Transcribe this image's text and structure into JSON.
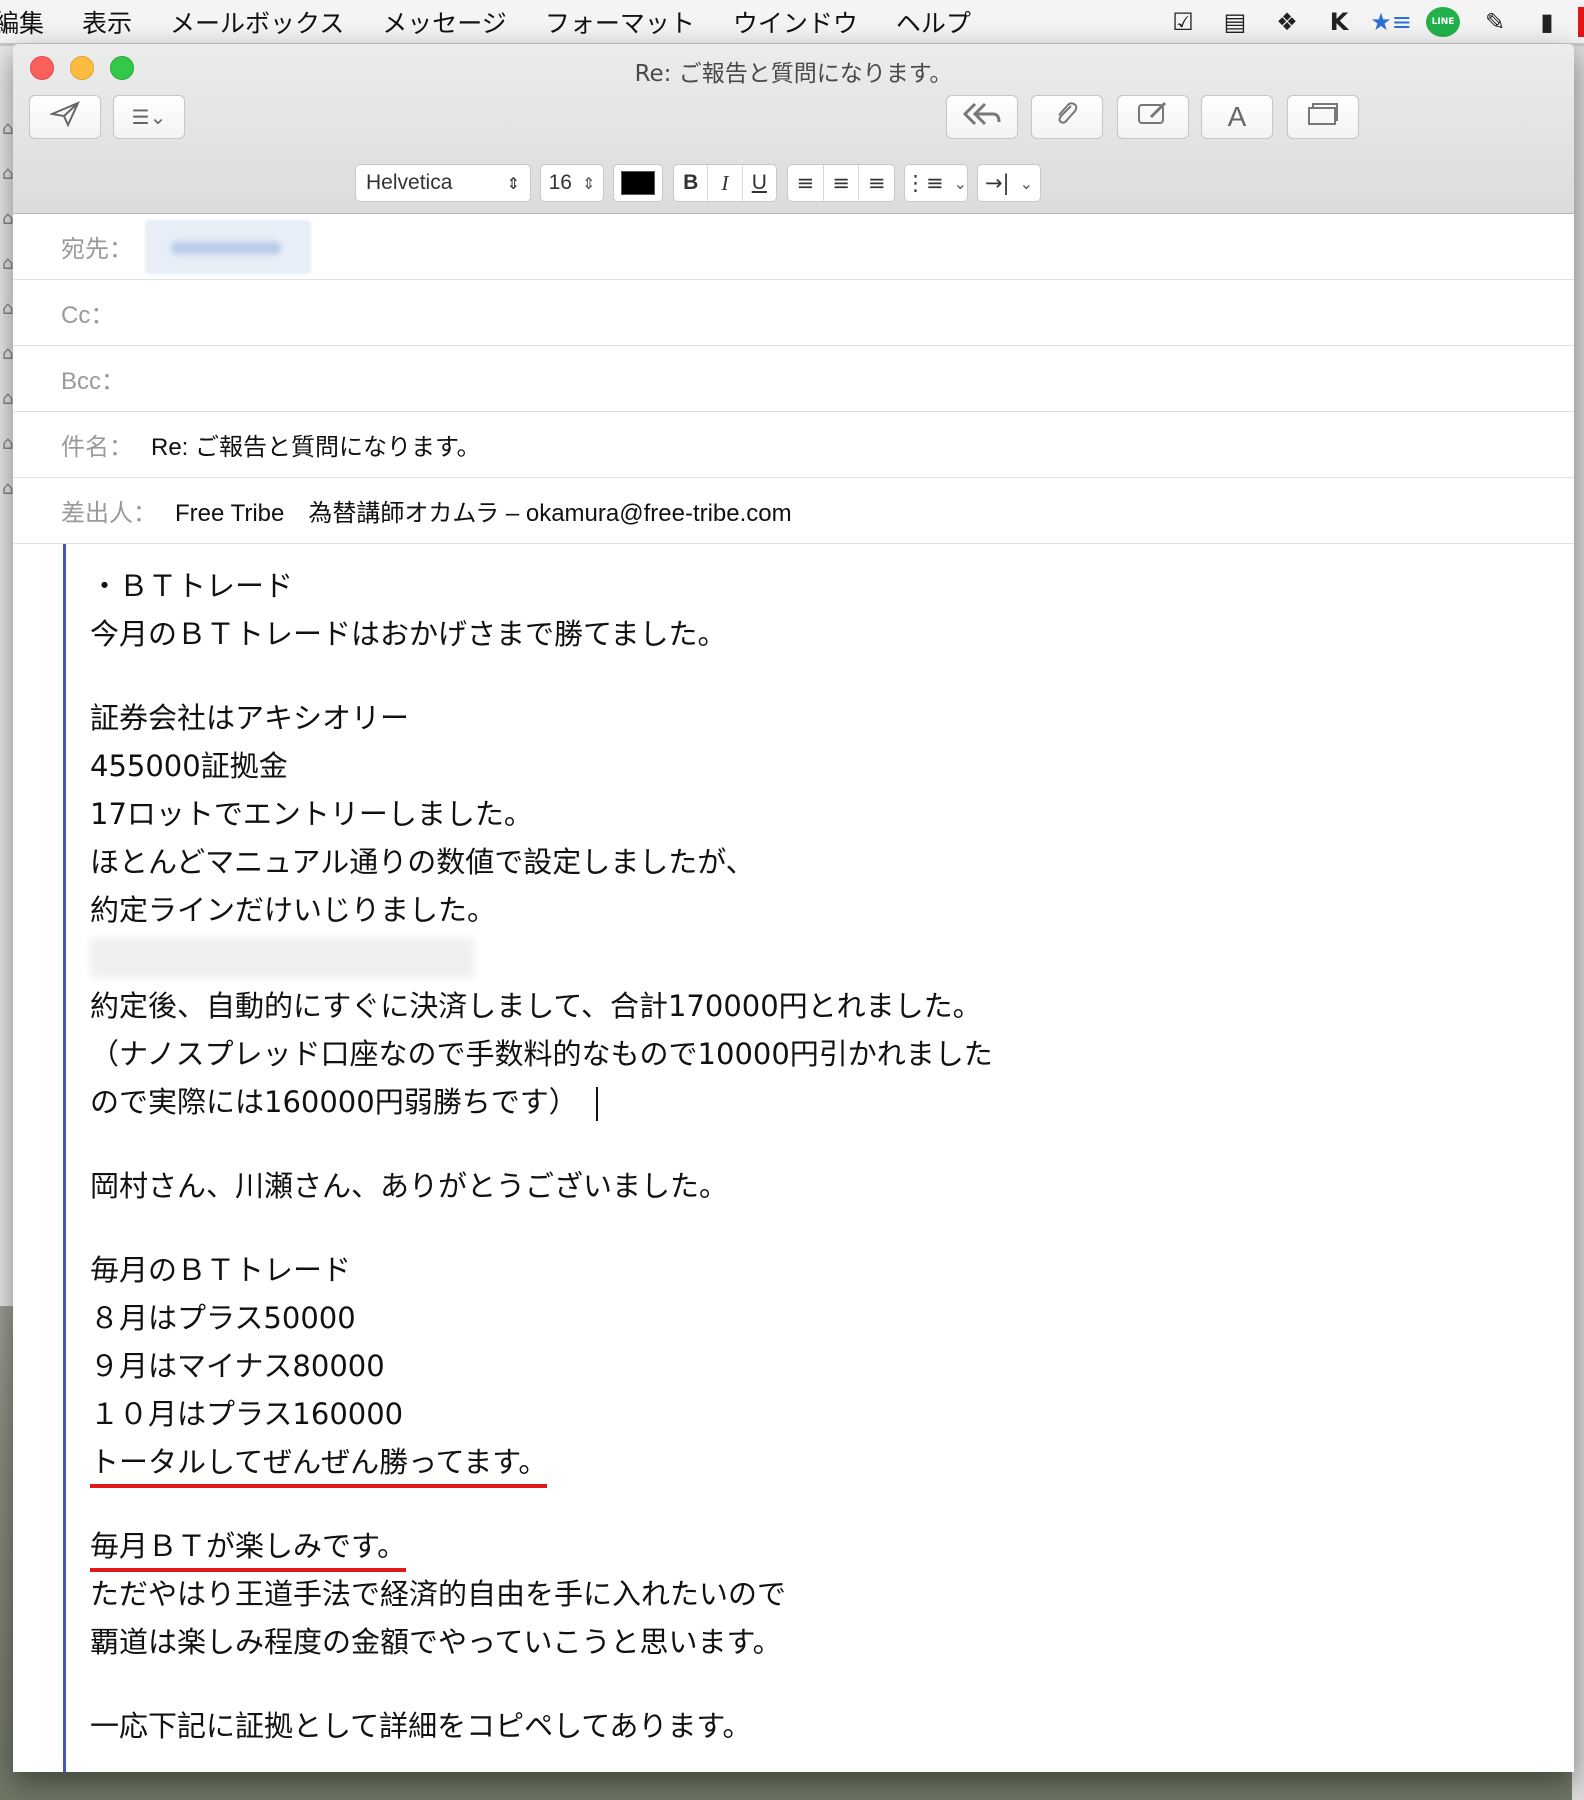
{
  "menubar": {
    "items": [
      "編集",
      "表示",
      "メールボックス",
      "メッセージ",
      "フォーマット",
      "ウインドウ",
      "ヘルプ"
    ],
    "tray_icons": [
      "checklist-icon",
      "film-icon",
      "dropbox-icon",
      "k-app-icon",
      "star-app-icon",
      "line-icon",
      "pen-icon",
      "clipboard-icon"
    ],
    "line_label": "LINE"
  },
  "window": {
    "title": "Re: ご報告と質問になります。"
  },
  "toolbar": {
    "send_icon": "paper-plane-icon",
    "header_fields_icon": "list-icon",
    "reply_all_icon": "reply-all-icon",
    "attach_icon": "paperclip-icon",
    "markup_icon": "markup-icon",
    "font_button_label": "A",
    "photo_browser_icon": "photo-browser-icon"
  },
  "format_bar": {
    "font_family": "Helvetica",
    "font_size": "16",
    "text_color": "#000000",
    "bold_label": "B",
    "italic_label": "I",
    "underline_label": "U"
  },
  "fields": {
    "to_label": "宛先：",
    "cc_label": "Cc：",
    "bcc_label": "Bcc：",
    "subject_label": "件名：",
    "subject_value": "Re: ご報告と質問になります。",
    "from_label": "差出人：",
    "from_value": "Free Tribe　為替講師オカムラ – okamura@free-tribe.com"
  },
  "body": {
    "p1": [
      "・ＢＴトレード",
      "今月のＢＴトレードはおかげさまで勝てました。"
    ],
    "p2": [
      "証券会社はアキシオリー",
      "455000証拠金",
      "17ロットでエントリーしました。",
      "ほとんどマニュアル通りの数値で設定しましたが、",
      "約定ラインだけいじりました。"
    ],
    "p2b": [
      "約定後、自動的にすぐに決済しまして、合計170000円とれました。",
      "（ナノスプレッド口座なので手数料的なもので10000円引かれました",
      "ので実際には160000円弱勝ちです）"
    ],
    "p3": [
      "岡村さん、川瀬さん、ありがとうございました。"
    ],
    "p4": [
      "毎月のＢＴトレード",
      "８月はプラス50000",
      "９月はマイナス80000",
      "１０月はプラス160000",
      "トータルしてぜんぜん勝ってます。"
    ],
    "p5": [
      "毎月ＢＴが楽しみです。",
      "ただやはり王道手法で経済的自由を手に入れたいので",
      "覇道は楽しみ程度の金額でやっていこうと思います。"
    ],
    "p6": [
      "一応下記に証拠として詳細をコピペしてあります。"
    ],
    "quote_bar_color": "#4257c6",
    "highlight_color": "#e01818"
  }
}
